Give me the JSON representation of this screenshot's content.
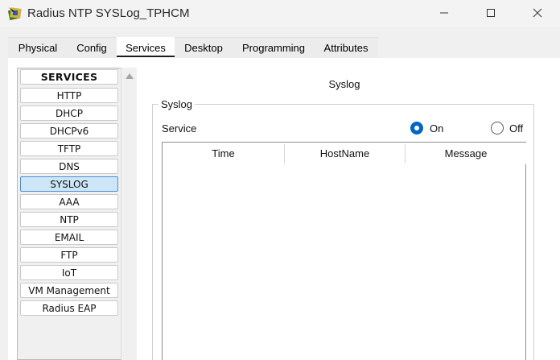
{
  "window": {
    "title": "Radius NTP SYSLog_TPHCM",
    "controls": [
      "minimize",
      "maximize",
      "close"
    ]
  },
  "tabs": [
    {
      "label": "Physical",
      "active": false
    },
    {
      "label": "Config",
      "active": false
    },
    {
      "label": "Services",
      "active": true
    },
    {
      "label": "Desktop",
      "active": false
    },
    {
      "label": "Programming",
      "active": false
    },
    {
      "label": "Attributes",
      "active": false
    }
  ],
  "services": {
    "header": "SERVICES",
    "items": [
      "HTTP",
      "DHCP",
      "DHCPv6",
      "TFTP",
      "DNS",
      "SYSLOG",
      "AAA",
      "NTP",
      "EMAIL",
      "FTP",
      "IoT",
      "VM Management",
      "Radius EAP"
    ],
    "selected": "SYSLOG"
  },
  "panel": {
    "title": "Syslog",
    "group_label": "Syslog",
    "service_label": "Service",
    "radio_on_label": "On",
    "radio_off_label": "Off",
    "service_state": "On"
  },
  "table": {
    "columns": [
      "Time",
      "HostName",
      "Message"
    ],
    "rows": []
  },
  "colors": {
    "accent": "#0067c0",
    "selected_bg": "#cde6f7",
    "selected_border": "#4a8fd0"
  }
}
